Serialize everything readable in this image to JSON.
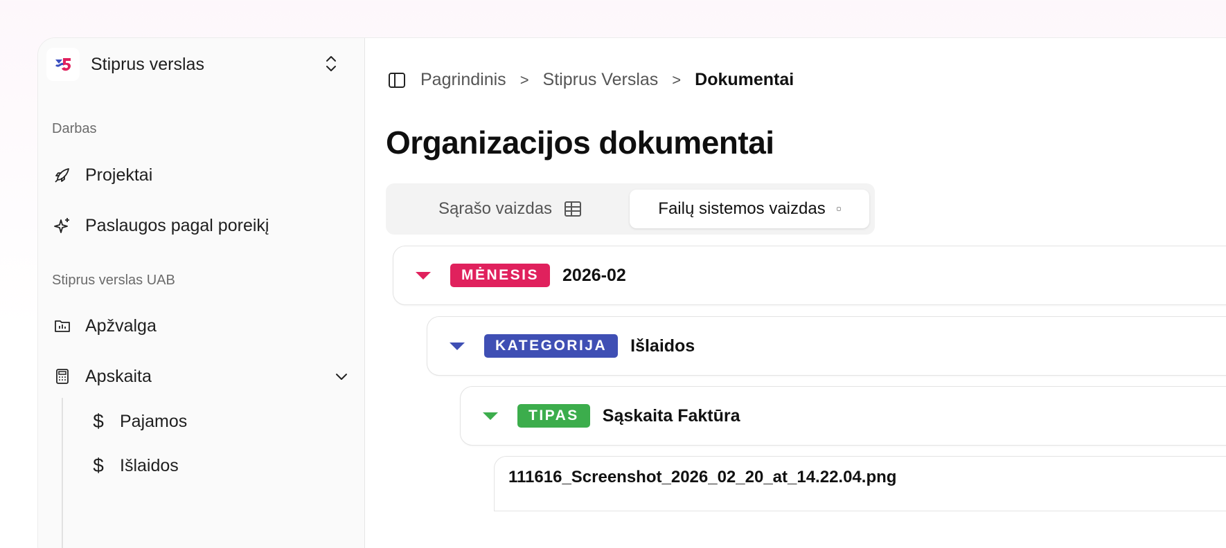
{
  "org": {
    "name": "Stiprus verslas"
  },
  "sidebar": {
    "section1": "Darbas",
    "work_items": [
      {
        "label": "Projektai",
        "icon": "rocket-icon"
      },
      {
        "label": "Paslaugos pagal poreikį",
        "icon": "sparkles-icon"
      }
    ],
    "section2": "Stiprus verslas UAB",
    "company_items": [
      {
        "label": "Apžvalga",
        "icon": "folder-chart-icon"
      },
      {
        "label": "Apskaita",
        "icon": "calculator-icon"
      }
    ],
    "apskaita_sub": [
      {
        "label": "Pajamos",
        "icon": "dollar-icon"
      },
      {
        "label": "Išlaidos",
        "icon": "dollar-icon"
      }
    ]
  },
  "breadcrumb": {
    "items": [
      "Pagrindinis",
      "Stiprus Verslas"
    ],
    "current": "Dokumentai"
  },
  "page": {
    "title": "Organizacijos dokumentai"
  },
  "view_toggle": {
    "list_label": "Sąrašo vaizdas",
    "files_label": "Failų sistemos vaizdas",
    "active": "files"
  },
  "tree": [
    {
      "tag": "MĖNESIS",
      "value": "2026-02",
      "color": "#e0215d"
    },
    {
      "tag": "KATEGORIJA",
      "value": "Išlaidos",
      "color": "#3f4fb4"
    },
    {
      "tag": "TIPAS",
      "value": "Sąskaita Faktūra",
      "color": "#3cad4c"
    }
  ],
  "file": {
    "name": "111616_Screenshot_2026_02_20_at_14.22.04.png"
  }
}
